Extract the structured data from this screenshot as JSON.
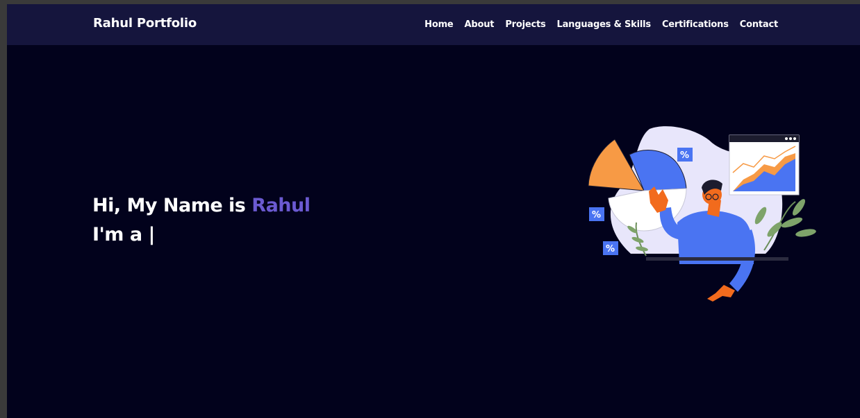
{
  "brand": "Rahul Portfolio",
  "nav": [
    {
      "label": "Home"
    },
    {
      "label": "About"
    },
    {
      "label": "Projects"
    },
    {
      "label": "Languages & Skills"
    },
    {
      "label": "Certifications"
    },
    {
      "label": "Contact"
    }
  ],
  "hero": {
    "greeting_prefix": "Hi, My Name is",
    "name": "Rahul",
    "role_prefix": "I'm a",
    "cursor": "|"
  },
  "illustration": {
    "percent_badges": [
      "%",
      "%",
      "%"
    ]
  },
  "colors": {
    "background": "#02021c",
    "navbar": "#15153d",
    "accent": "#6b5ad1",
    "illustration_blue": "#4a74f2",
    "illustration_orange": "#f79a45"
  }
}
